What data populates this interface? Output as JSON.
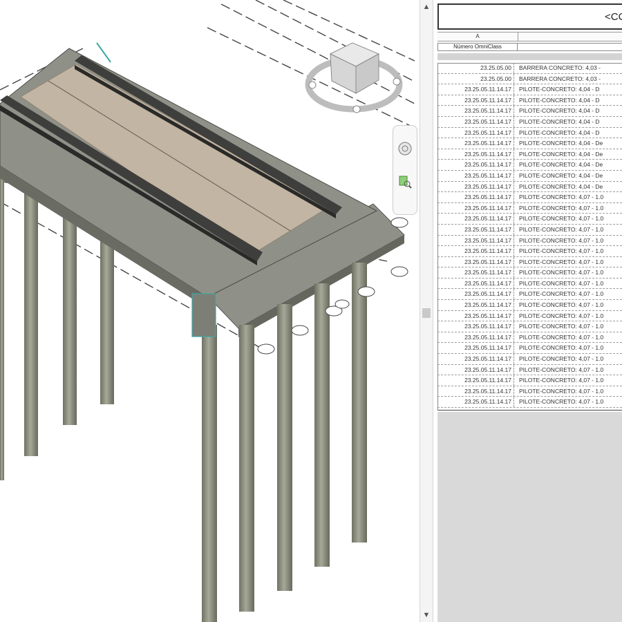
{
  "schedule": {
    "title": "<CC",
    "column_letter": "A",
    "header": "Número OmniClass",
    "rows": [
      {
        "code": "23.25.05.00",
        "desc": "BARRERA CONCRETO: 4,03 -"
      },
      {
        "code": "23.25.05.00",
        "desc": "BARRERA CONCRETO: 4,03 -"
      },
      {
        "code": "23.25.05.11.14.17",
        "desc": "PILOTE-CONCRETO: 4,04 - D"
      },
      {
        "code": "23.25.05.11.14.17",
        "desc": "PILOTE-CONCRETO: 4,04 - D"
      },
      {
        "code": "23.25.05.11.14.17",
        "desc": "PILOTE-CONCRETO: 4,04 - D"
      },
      {
        "code": "23.25.05.11.14.17",
        "desc": "PILOTE-CONCRETO: 4,04 - D"
      },
      {
        "code": "23.25.05.11.14.17",
        "desc": "PILOTE-CONCRETO: 4,04 - D"
      },
      {
        "code": "23.25.05.11.14.17",
        "desc": "PILOTE-CONCRETO: 4,04 - De"
      },
      {
        "code": "23.25.05.11.14.17",
        "desc": "PILOTE-CONCRETO: 4,04 - De"
      },
      {
        "code": "23.25.05.11.14.17",
        "desc": "PILOTE-CONCRETO: 4,04 - De"
      },
      {
        "code": "23.25.05.11.14.17",
        "desc": "PILOTE-CONCRETO: 4,04 - De"
      },
      {
        "code": "23.25.05.11.14.17",
        "desc": "PILOTE-CONCRETO: 4,04 - De"
      },
      {
        "code": "23.25.05.11.14.17",
        "desc": "PILOTE-CONCRETO: 4,07 - 1.0"
      },
      {
        "code": "23.25.05.11.14.17",
        "desc": "PILOTE-CONCRETO: 4,07 - 1.0"
      },
      {
        "code": "23.25.05.11.14.17",
        "desc": "PILOTE-CONCRETO: 4,07 - 1.0"
      },
      {
        "code": "23.25.05.11.14.17",
        "desc": "PILOTE-CONCRETO: 4,07 - 1.0"
      },
      {
        "code": "23.25.05.11.14.17",
        "desc": "PILOTE-CONCRETO: 4,07 - 1.0"
      },
      {
        "code": "23.25.05.11.14.17",
        "desc": "PILOTE-CONCRETO: 4,07 - 1.0"
      },
      {
        "code": "23.25.05.11.14.17",
        "desc": "PILOTE-CONCRETO: 4,07 - 1.0"
      },
      {
        "code": "23.25.05.11.14.17",
        "desc": "PILOTE-CONCRETO: 4,07 - 1.0"
      },
      {
        "code": "23.25.05.11.14.17",
        "desc": "PILOTE-CONCRETO: 4,07 - 1.0"
      },
      {
        "code": "23.25.05.11.14.17",
        "desc": "PILOTE-CONCRETO: 4,07 - 1.0"
      },
      {
        "code": "23.25.05.11.14.17",
        "desc": "PILOTE-CONCRETO: 4,07 - 1.0"
      },
      {
        "code": "23.25.05.11.14.17",
        "desc": "PILOTE-CONCRETO: 4,07 - 1.0"
      },
      {
        "code": "23.25.05.11.14.17",
        "desc": "PILOTE-CONCRETO: 4,07 - 1.0"
      },
      {
        "code": "23.25.05.11.14.17",
        "desc": "PILOTE-CONCRETO: 4,07 - 1.0"
      },
      {
        "code": "23.25.05.11.14.17",
        "desc": "PILOTE-CONCRETO: 4,07 - 1.0"
      },
      {
        "code": "23.25.05.11.14.17",
        "desc": "PILOTE-CONCRETO: 4,07 - 1.0"
      },
      {
        "code": "23.25.05.11.14.17",
        "desc": "PILOTE-CONCRETO: 4,07 - 1.0"
      },
      {
        "code": "23.25.05.11.14.17",
        "desc": "PILOTE-CONCRETO: 4,07 - 1.0"
      },
      {
        "code": "23.25.05.11.14.17",
        "desc": "PILOTE-CONCRETO: 4,07 - 1.0"
      },
      {
        "code": "23.25.05.11.14.17",
        "desc": "PILOTE-CONCRETO: 4,07 - 1.0"
      }
    ]
  },
  "viewcube": {
    "face_top": "",
    "face_front": "",
    "face_right": ""
  },
  "icons": {
    "steering_wheel": "steering-wheel-icon",
    "zoom_region": "zoom-region-icon",
    "scroll_up": "scroll-up-arrow-icon",
    "scroll_down": "scroll-down-arrow-icon"
  },
  "colors": {
    "deck_top": "#8f9188",
    "deck_side": "#6f7169",
    "road_surface": "#c3b5a3",
    "barrier": "#3e3e3c",
    "pile": "#8e9080",
    "schedule_border": "#333333"
  }
}
